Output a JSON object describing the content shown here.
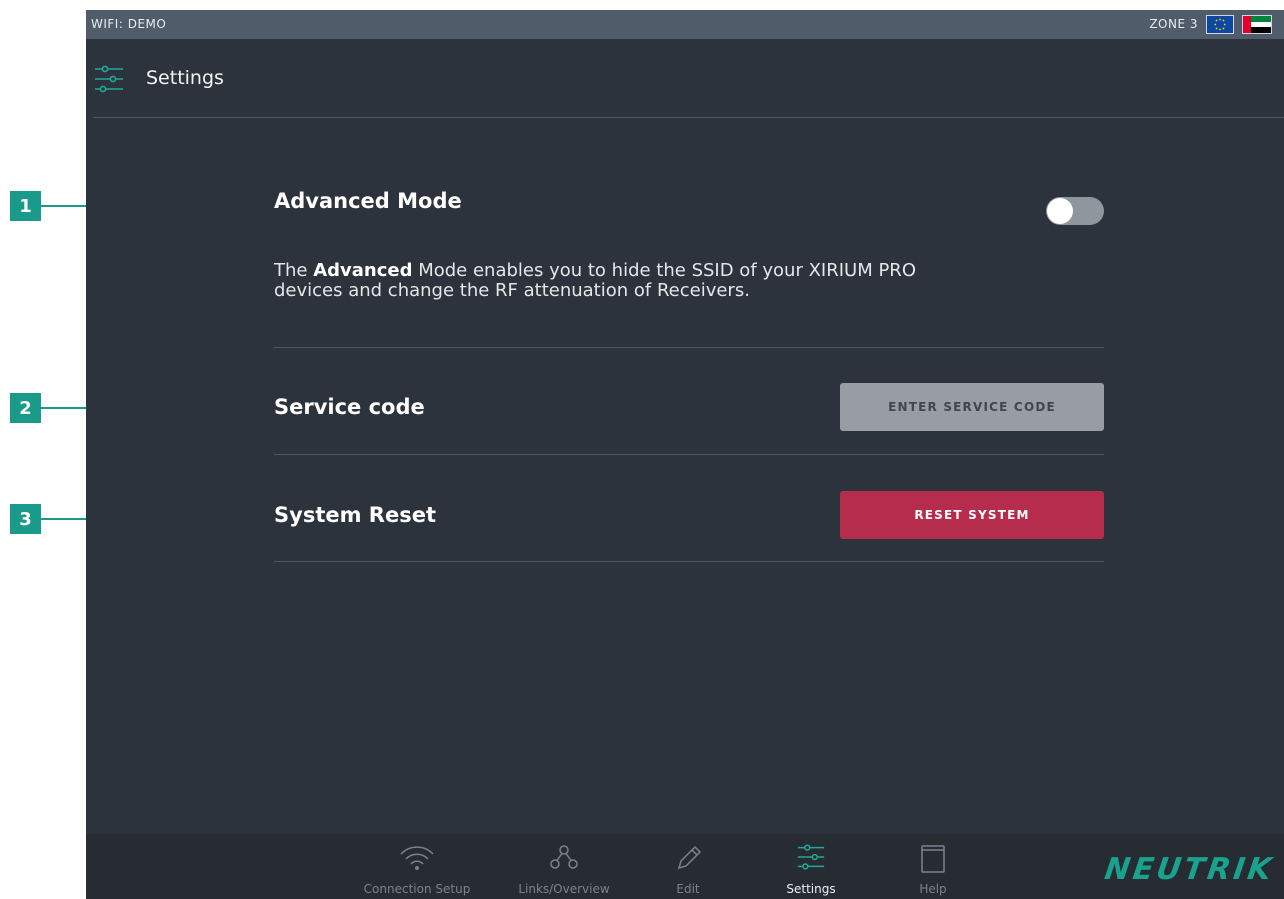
{
  "callouts": [
    {
      "number": "1"
    },
    {
      "number": "2"
    },
    {
      "number": "3"
    }
  ],
  "status_bar": {
    "wifi": "WIFI: DEMO",
    "zone": "ZONE 3"
  },
  "header": {
    "title": "Settings",
    "icon": "sliders-icon"
  },
  "settings": {
    "advanced": {
      "label": "Advanced Mode",
      "enabled": false,
      "desc_prefix": "The ",
      "desc_bold": "Advanced",
      "desc_rest": " Mode enables you to hide the SSID of your XIRIUM PRO devices and change the RF attenuation of Receivers."
    },
    "service": {
      "label": "Service code",
      "button": "ENTER SERVICE CODE"
    },
    "reset": {
      "label": "System Reset",
      "button": "RESET SYSTEM"
    }
  },
  "tabbar": {
    "tabs": [
      {
        "label": "Connection Setup",
        "icon": "wifi-icon"
      },
      {
        "label": "Links/Overview",
        "icon": "links-icon"
      },
      {
        "label": "Edit",
        "icon": "pencil-icon"
      },
      {
        "label": "Settings",
        "icon": "sliders-icon",
        "active": true
      },
      {
        "label": "Help",
        "icon": "book-icon"
      }
    ],
    "logo": "NEUTRIK"
  },
  "colors": {
    "accent": "#1a9a8a",
    "background": "#2d333c",
    "status_bar": "#505c69",
    "reset_button": "#b52c4d",
    "service_button": "#979da3"
  }
}
